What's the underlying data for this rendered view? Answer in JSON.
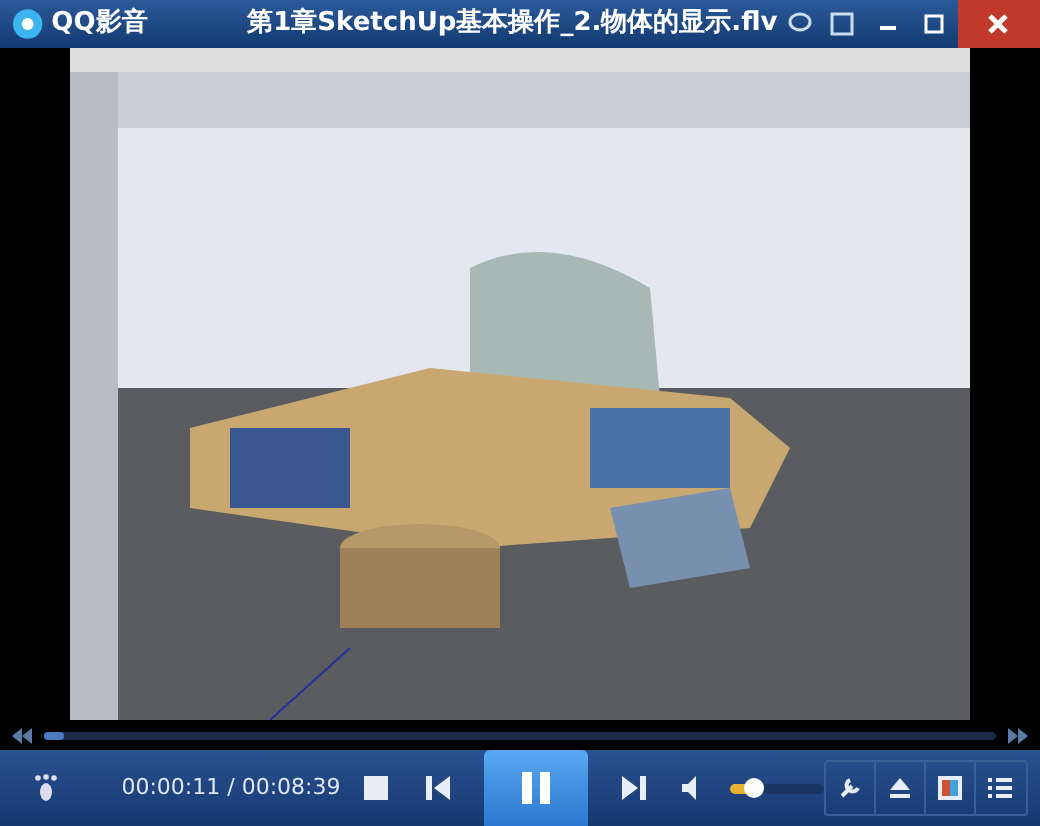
{
  "app": {
    "name": "QQ影音"
  },
  "window": {
    "title": "第1章SketchUp基本操作_2.物体的显示.flv"
  },
  "seek": {
    "level": 0.022
  },
  "controls": {
    "time": "00:00:11 / 00:08:39",
    "playing": true,
    "volume": {
      "level": 0.25
    }
  }
}
